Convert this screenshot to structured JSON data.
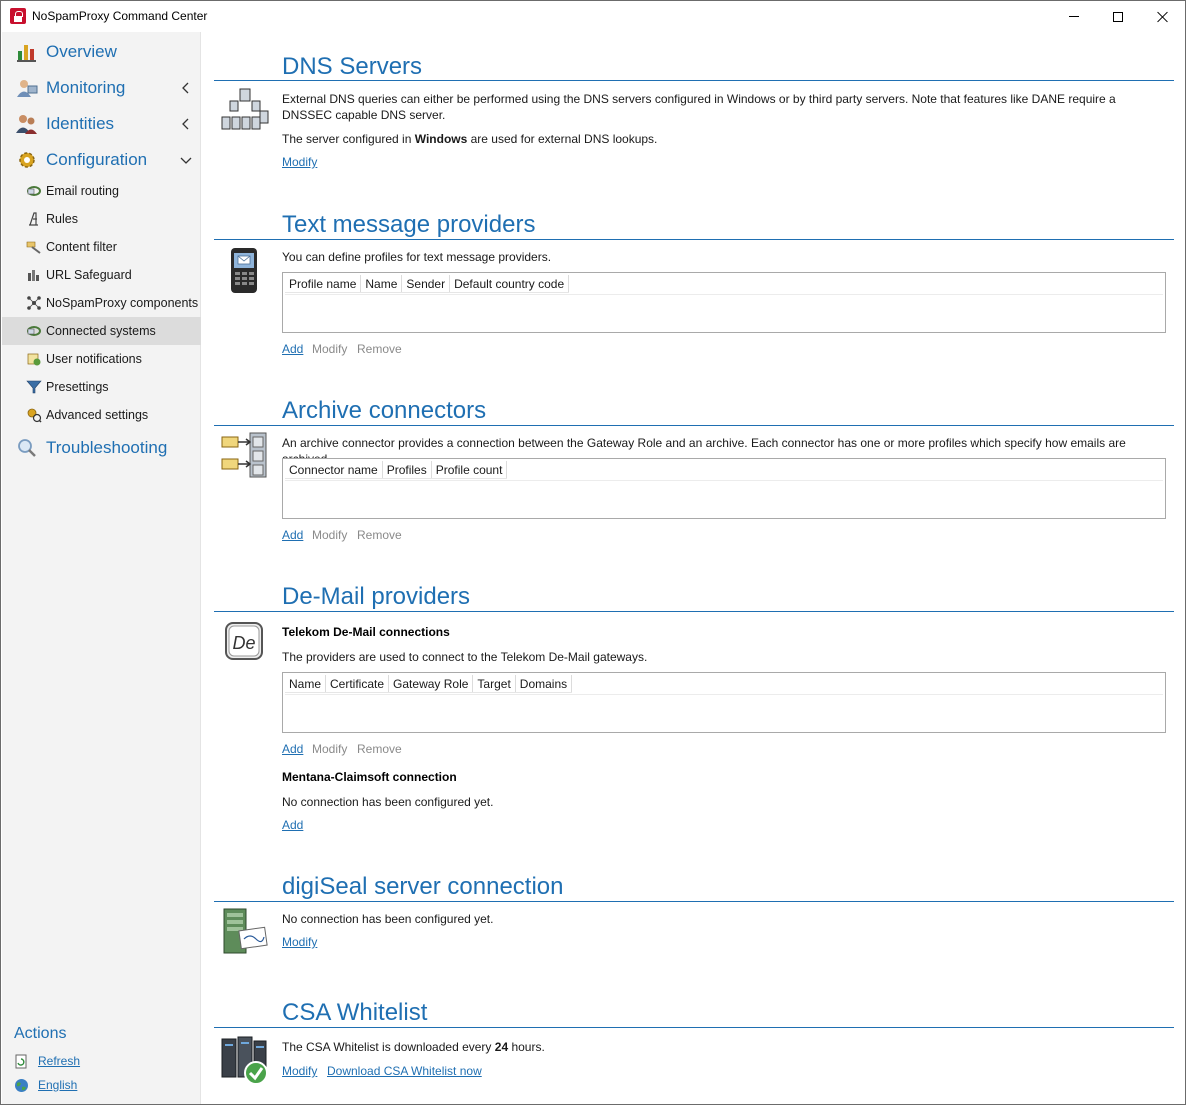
{
  "window": {
    "title": "NoSpamProxy Command Center"
  },
  "sidebar": {
    "top_items": [
      {
        "label": "Overview",
        "icon": "overview-chart-icon"
      },
      {
        "label": "Monitoring",
        "icon": "monitoring-icon",
        "expandable": true
      },
      {
        "label": "Identities",
        "icon": "identities-users-icon",
        "expandable": true
      },
      {
        "label": "Configuration",
        "icon": "configuration-gear-icon",
        "expanded": true
      }
    ],
    "config_items": [
      {
        "label": "Email routing",
        "icon": "email-routing-icon"
      },
      {
        "label": "Rules",
        "icon": "rules-icon"
      },
      {
        "label": "Content filter",
        "icon": "content-filter-icon"
      },
      {
        "label": "URL Safeguard",
        "icon": "url-safeguard-icon"
      },
      {
        "label": "NoSpamProxy components",
        "icon": "components-icon"
      },
      {
        "label": "Connected systems",
        "icon": "connected-systems-icon",
        "active": true
      },
      {
        "label": "User notifications",
        "icon": "user-notifications-icon"
      },
      {
        "label": "Presettings",
        "icon": "presettings-funnel-icon"
      },
      {
        "label": "Advanced settings",
        "icon": "advanced-settings-icon"
      }
    ],
    "troubleshooting": {
      "label": "Troubleshooting",
      "icon": "troubleshooting-magnifier-icon"
    },
    "actions": {
      "title": "Actions",
      "refresh": "Refresh",
      "language": "English"
    }
  },
  "sections": {
    "dns": {
      "title": "DNS Servers",
      "description": "External DNS queries can either be performed using the DNS servers configured in Windows or by third party servers. Note that features like DANE require a DNSSEC capable DNS server.",
      "status_prefix": "The server configured in ",
      "status_value": "Windows",
      "status_suffix": " are used for external DNS lookups.",
      "modify": "Modify"
    },
    "sms": {
      "title": "Text message providers",
      "description": "You can define profiles for text message providers.",
      "columns": [
        "Profile name",
        "Name",
        "Sender",
        "Default country code"
      ],
      "add": "Add",
      "modify": "Modify",
      "remove": "Remove"
    },
    "archive": {
      "title": "Archive connectors",
      "description": "An archive connector provides a connection between the Gateway Role and an archive. Each connector has one or more profiles which specify how emails are archived.",
      "columns": [
        "Connector name",
        "Profiles",
        "Profile count"
      ],
      "add": "Add",
      "modify": "Modify",
      "remove": "Remove"
    },
    "demail": {
      "title": "De-Mail providers",
      "telekom_heading": "Telekom De-Mail connections",
      "telekom_description": "The providers are used to connect to the Telekom De-Mail gateways.",
      "columns": [
        "Name",
        "Certificate",
        "Gateway Role",
        "Target",
        "Domains"
      ],
      "add": "Add",
      "modify": "Modify",
      "remove": "Remove",
      "mentana_heading": "Mentana-Claimsoft connection",
      "mentana_status": "No connection has been configured yet.",
      "mentana_add": "Add"
    },
    "digiseal": {
      "title": "digiSeal server connection",
      "status": "No connection has been configured yet.",
      "modify": "Modify"
    },
    "csa": {
      "title": "CSA Whitelist",
      "status_prefix": "The CSA Whitelist is downloaded every ",
      "status_value": "24",
      "status_suffix": " hours.",
      "modify": "Modify",
      "download": "Download CSA Whitelist now"
    }
  },
  "colors": {
    "accent": "#1f6fb2",
    "sidebar_bg": "#f3f3f3",
    "active_item": "#dcdcdc",
    "disabled": "#8a8a8a"
  }
}
